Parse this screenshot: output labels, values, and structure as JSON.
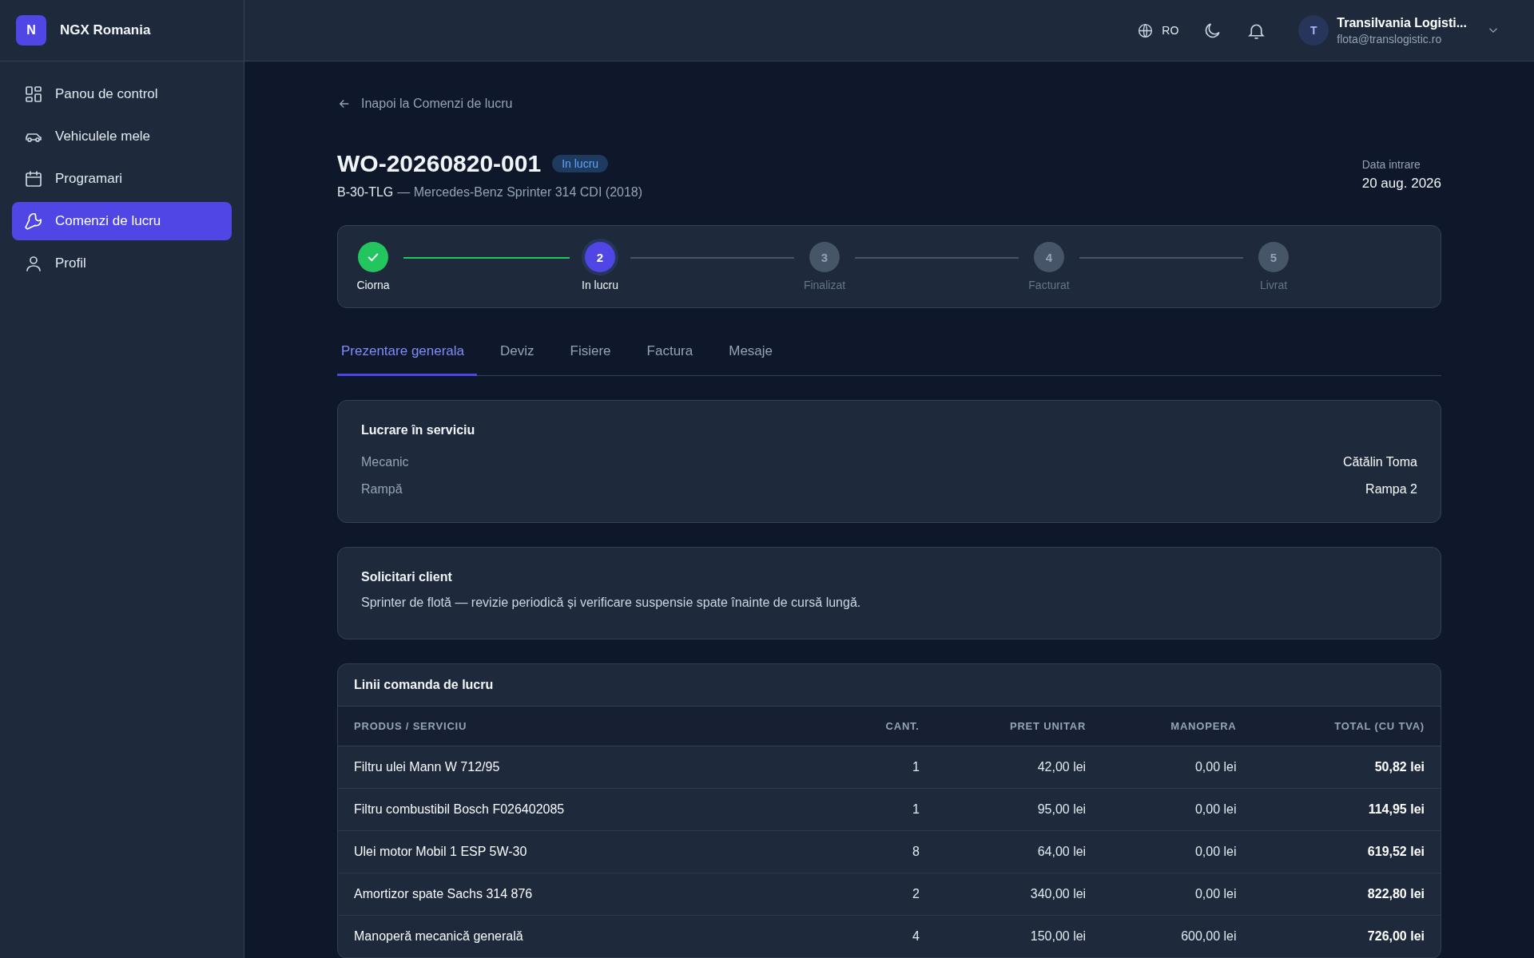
{
  "brand": {
    "initial": "N",
    "name": "NGX Romania"
  },
  "sidebar": {
    "items": [
      {
        "label": "Panou de control",
        "selected": false
      },
      {
        "label": "Vehiculele mele",
        "selected": false
      },
      {
        "label": "Programari",
        "selected": false
      },
      {
        "label": "Comenzi de lucru",
        "selected": true
      },
      {
        "label": "Profil",
        "selected": false
      }
    ]
  },
  "topbar": {
    "language": "RO",
    "user": {
      "initial": "T",
      "name": "Transilvania Logisti...",
      "email": "flota@translogistic.ro"
    }
  },
  "back_link": "Inapoi la Comenzi de lucru",
  "header": {
    "title": "WO-20260820-001",
    "status": "In lucru",
    "plate": "B-30-TLG",
    "vehicle": "— Mercedes-Benz Sprinter 314 CDI (2018)",
    "date_label": "Data intrare",
    "date": "20 aug. 2026"
  },
  "steps": [
    {
      "label": "Ciorna",
      "kind": "done"
    },
    {
      "number": "2",
      "label": "In lucru",
      "kind": "current"
    },
    {
      "number": "3",
      "label": "Finalizat",
      "kind": "pending"
    },
    {
      "number": "4",
      "label": "Facturat",
      "kind": "pending"
    },
    {
      "number": "5",
      "label": "Livrat",
      "kind": "pending"
    }
  ],
  "tabs": [
    {
      "label": "Prezentare generala",
      "selected": true
    },
    {
      "label": "Deviz",
      "selected": false
    },
    {
      "label": "Fisiere",
      "selected": false
    },
    {
      "label": "Factura",
      "selected": false
    },
    {
      "label": "Mesaje",
      "selected": false
    }
  ],
  "service_card": {
    "title": "Lucrare în serviciu",
    "rows": [
      {
        "label": "Mecanic",
        "value": "Cătălin Toma"
      },
      {
        "label": "Rampă",
        "value": "Rampa 2"
      }
    ]
  },
  "requests_card": {
    "title": "Solicitari client",
    "text": "Sprinter de flotă — revizie periodică și verificare suspensie spate înainte de cursă lungă."
  },
  "table": {
    "title": "Linii comanda de lucru",
    "columns": [
      "PRODUS / SERVICIU",
      "CANT.",
      "PRET UNITAR",
      "MANOPERA",
      "TOTAL (CU TVA)"
    ],
    "rows": [
      [
        "Filtru ulei Mann W 712/95",
        "1",
        "42,00 lei",
        "0,00 lei",
        "50,82 lei"
      ],
      [
        "Filtru combustibil Bosch F026402085",
        "1",
        "95,00 lei",
        "0,00 lei",
        "114,95 lei"
      ],
      [
        "Ulei motor Mobil 1 ESP 5W-30",
        "8",
        "64,00 lei",
        "0,00 lei",
        "619,52 lei"
      ],
      [
        "Amortizor spate Sachs 314 876",
        "2",
        "340,00 lei",
        "0,00 lei",
        "822,80 lei"
      ],
      [
        "Manoperă mecanică generală",
        "4",
        "150,00 lei",
        "600,00 lei",
        "726,00 lei"
      ]
    ]
  }
}
